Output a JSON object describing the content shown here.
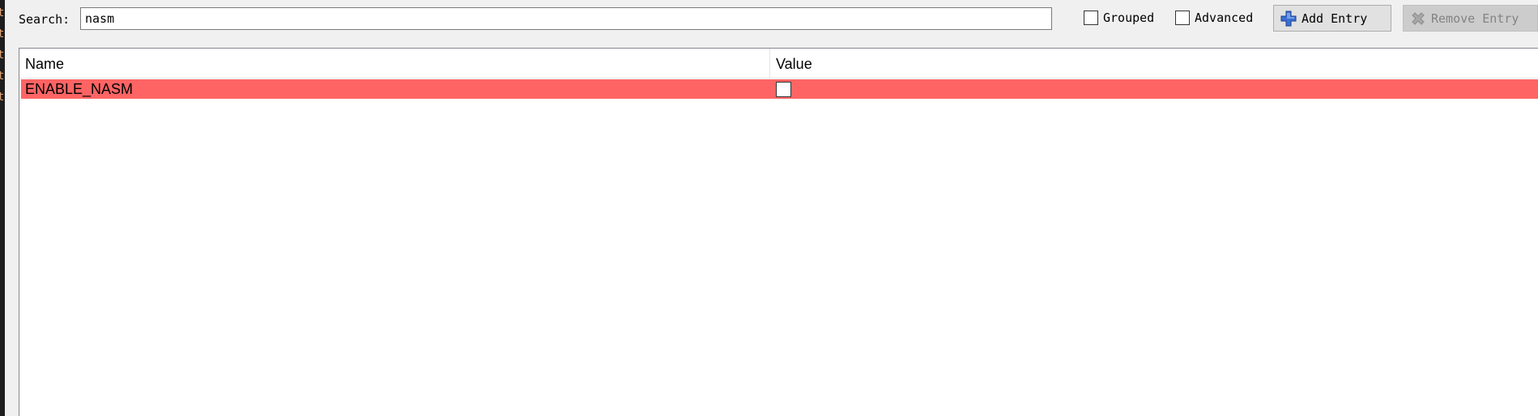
{
  "left_strip": {
    "glyphs": [
      "t",
      "t",
      "t",
      "t",
      "t"
    ]
  },
  "toolbar": {
    "search_label": "Search:",
    "search_value": "nasm",
    "grouped_label": "Grouped",
    "grouped_checked": false,
    "advanced_label": "Advanced",
    "advanced_checked": false,
    "add_entry_label": "Add Entry",
    "remove_entry_label": "Remove Entry",
    "remove_entry_disabled": true
  },
  "table": {
    "columns": [
      "Name",
      "Value"
    ],
    "rows": [
      {
        "name": "ENABLE_NASM",
        "value_checked": false,
        "highlight_color": "#ff6464"
      }
    ]
  },
  "icons": {
    "add": "plus-icon",
    "remove": "x-icon"
  }
}
